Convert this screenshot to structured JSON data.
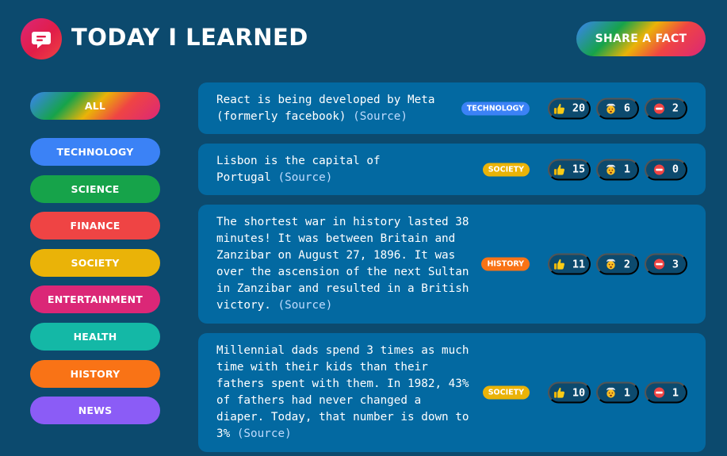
{
  "app": {
    "title": "TODAY I LEARNED"
  },
  "header": {
    "share_label": "SHARE A FACT"
  },
  "categories": [
    {
      "label": "ALL",
      "color": "gradient"
    },
    {
      "label": "TECHNOLOGY",
      "color": "#3b82f6"
    },
    {
      "label": "SCIENCE",
      "color": "#16a34a"
    },
    {
      "label": "FINANCE",
      "color": "#ef4444"
    },
    {
      "label": "SOCIETY",
      "color": "#eab308"
    },
    {
      "label": "ENTERTAINMENT",
      "color": "#db2777"
    },
    {
      "label": "HEALTH",
      "color": "#14b8a6"
    },
    {
      "label": "HISTORY",
      "color": "#f97316"
    },
    {
      "label": "NEWS",
      "color": "#8b5cf6"
    }
  ],
  "facts": [
    {
      "text": "React is being developed by Meta (formerly facebook)",
      "source_label": "(Source)",
      "category": "TECHNOLOGY",
      "category_color": "#3b82f6",
      "votes": {
        "interesting": "20",
        "mindblowing": "6",
        "false": "2"
      }
    },
    {
      "text": "Lisbon is the capital of Portugal",
      "source_label": "(Source)",
      "category": "SOCIETY",
      "category_color": "#eab308",
      "votes": {
        "interesting": "15",
        "mindblowing": "1",
        "false": "0"
      }
    },
    {
      "text": "The shortest war in history lasted 38 minutes! It was between Britain and Zanzibar on August 27, 1896. It was over the ascension of the next Sultan in Zanzibar and resulted in a British victory.",
      "source_label": "(Source)",
      "category": "HISTORY",
      "category_color": "#f97316",
      "votes": {
        "interesting": "11",
        "mindblowing": "2",
        "false": "3"
      }
    },
    {
      "text": "Millennial dads spend 3 times as much time with their kids than their fathers spent with them. In 1982, 43% of fathers had never changed a diaper. Today, that number is down to 3%",
      "source_label": "(Source)",
      "category": "SOCIETY",
      "category_color": "#eab308",
      "votes": {
        "interesting": "10",
        "mindblowing": "1",
        "false": "1"
      }
    }
  ],
  "icons": {
    "logo": "speech-bubble-icon",
    "interesting": "thumbs-up-icon",
    "mindblowing": "mind-blown-icon",
    "false": "no-entry-icon"
  },
  "colors": {
    "background": "#0c4a6e",
    "card": "#0369a1",
    "vote_bg": "#0c4a6e",
    "source_link": "#bfdbfe"
  }
}
